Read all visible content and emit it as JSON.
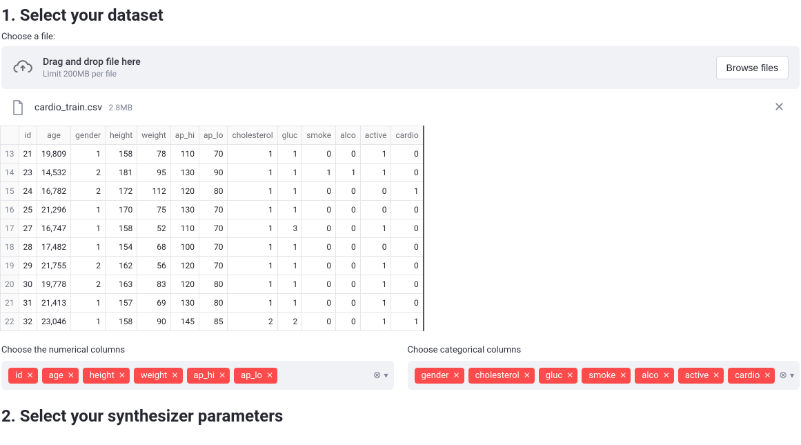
{
  "step1_title": "1. Select your dataset",
  "choose_file_label": "Choose a file:",
  "uploader": {
    "main_text": "Drag and drop file here",
    "sub_text": "Limit 200MB per file",
    "browse_label": "Browse files"
  },
  "uploaded_file": {
    "name": "cardio_train.csv",
    "size": "2.8MB"
  },
  "table": {
    "columns": [
      "id",
      "age",
      "gender",
      "height",
      "weight",
      "ap_hi",
      "ap_lo",
      "cholesterol",
      "gluc",
      "smoke",
      "alco",
      "active",
      "cardio"
    ],
    "rows": [
      {
        "idx": 13,
        "cells": [
          21,
          "19,809",
          1,
          158,
          78,
          110,
          70,
          1,
          1,
          0,
          0,
          1,
          0
        ]
      },
      {
        "idx": 14,
        "cells": [
          23,
          "14,532",
          2,
          181,
          95,
          130,
          90,
          1,
          1,
          1,
          1,
          1,
          0
        ]
      },
      {
        "idx": 15,
        "cells": [
          24,
          "16,782",
          2,
          172,
          112,
          120,
          80,
          1,
          1,
          0,
          0,
          0,
          1
        ]
      },
      {
        "idx": 16,
        "cells": [
          25,
          "21,296",
          1,
          170,
          75,
          130,
          70,
          1,
          1,
          0,
          0,
          0,
          0
        ]
      },
      {
        "idx": 17,
        "cells": [
          27,
          "16,747",
          1,
          158,
          52,
          110,
          70,
          1,
          3,
          0,
          0,
          1,
          0
        ]
      },
      {
        "idx": 18,
        "cells": [
          28,
          "17,482",
          1,
          154,
          68,
          100,
          70,
          1,
          1,
          0,
          0,
          0,
          0
        ]
      },
      {
        "idx": 19,
        "cells": [
          29,
          "21,755",
          2,
          162,
          56,
          120,
          70,
          1,
          1,
          0,
          0,
          1,
          0
        ]
      },
      {
        "idx": 20,
        "cells": [
          30,
          "19,778",
          2,
          163,
          83,
          120,
          80,
          1,
          1,
          0,
          0,
          1,
          0
        ]
      },
      {
        "idx": 21,
        "cells": [
          31,
          "21,413",
          1,
          157,
          69,
          130,
          80,
          1,
          1,
          0,
          0,
          1,
          0
        ]
      },
      {
        "idx": 22,
        "cells": [
          32,
          "23,046",
          1,
          158,
          90,
          145,
          85,
          2,
          2,
          0,
          0,
          1,
          1
        ]
      }
    ]
  },
  "numerical_label": "Choose the numerical columns",
  "categorical_label": "Choose categorical columns",
  "numerical_tags": [
    "id",
    "age",
    "height",
    "weight",
    "ap_hi",
    "ap_lo"
  ],
  "categorical_tags": [
    "gender",
    "cholesterol",
    "gluc",
    "smoke",
    "alco",
    "active",
    "cardio"
  ],
  "step2_title": "2. Select your synthesizer parameters"
}
